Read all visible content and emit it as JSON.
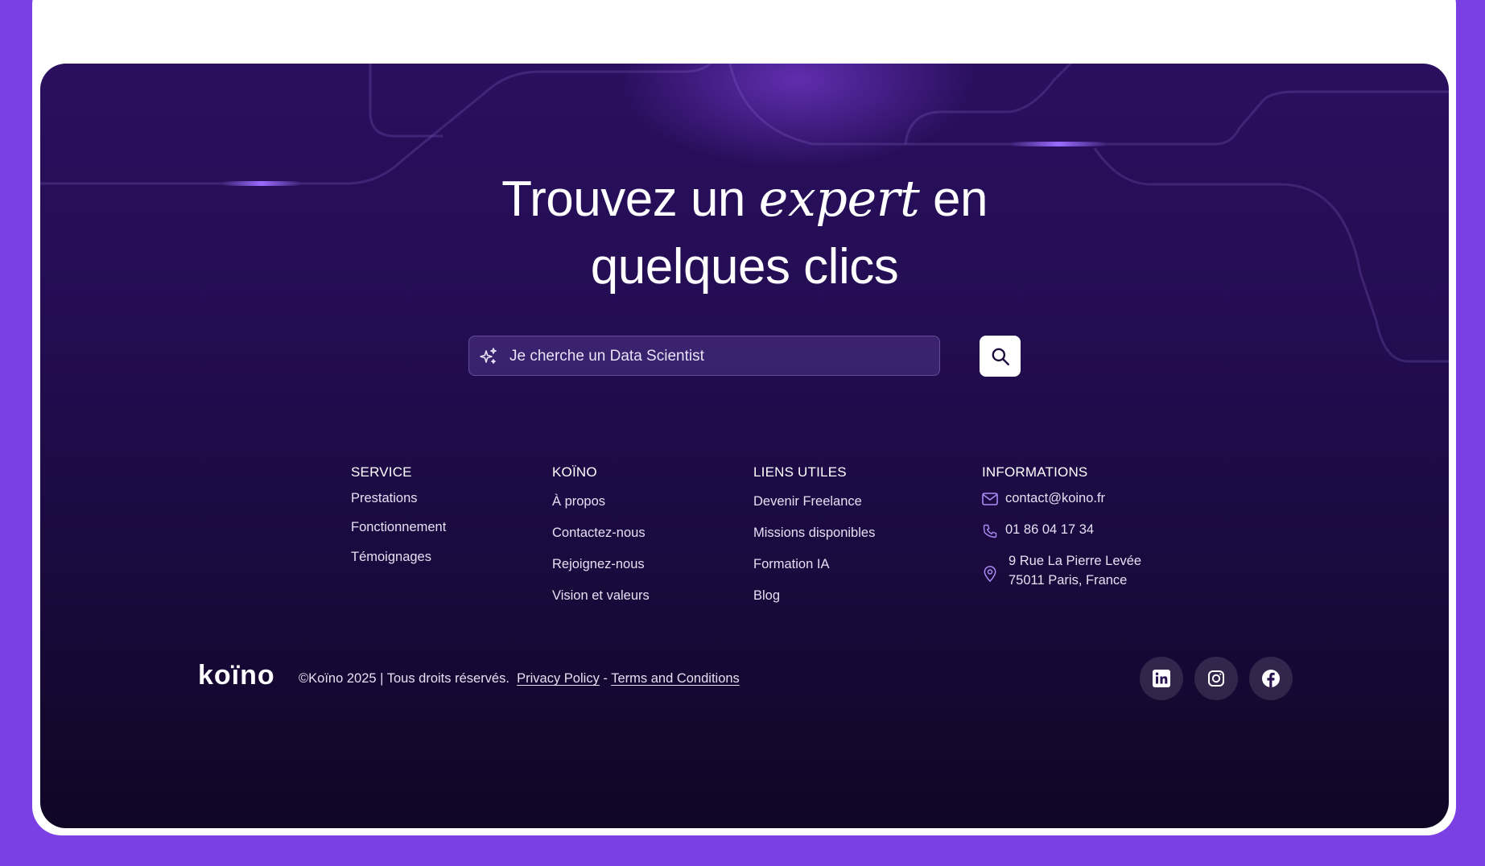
{
  "hero": {
    "title_line1_before": "Trouvez un ",
    "title_italic": "expert",
    "title_line1_after": " en",
    "title_line2": "quelques clics"
  },
  "search": {
    "placeholder": "Je cherche un Data Scientist",
    "sparkle_icon": "sparkle-icon",
    "button_icon": "search-icon"
  },
  "columns": {
    "service": {
      "title": "SERVICE",
      "links": [
        "Prestations",
        "Fonctionnement",
        "Témoignages"
      ]
    },
    "koino": {
      "title": "KOÏNO",
      "links": [
        "À propos",
        "Contactez-nous",
        "Rejoignez-nous",
        "Vision et valeurs"
      ]
    },
    "liens": {
      "title": "LIENS UTILES",
      "links": [
        "Devenir Freelance",
        "Missions disponibles",
        "Formation IA",
        "Blog"
      ]
    },
    "informations": {
      "title": "INFORMATIONS",
      "email": "contact@koino.fr",
      "phone": "01 86 04 17 34",
      "address_line1": "9 Rue La Pierre Levée",
      "address_line2": "75011 Paris, France"
    }
  },
  "bottom": {
    "logo": "koïno",
    "copyright": "©Koïno 2025 | Tous droits réservés.",
    "privacy": "Privacy Policy",
    "separator": "-",
    "terms": "Terms and Conditions",
    "socials": [
      "linkedin-icon",
      "instagram-icon",
      "facebook-icon"
    ]
  },
  "colors": {
    "page_background": "#7b3fe4",
    "panel_top": "#2a0f5e",
    "panel_bottom": "#100625",
    "accent": "#8b5cf6",
    "text": "#ffffff"
  }
}
